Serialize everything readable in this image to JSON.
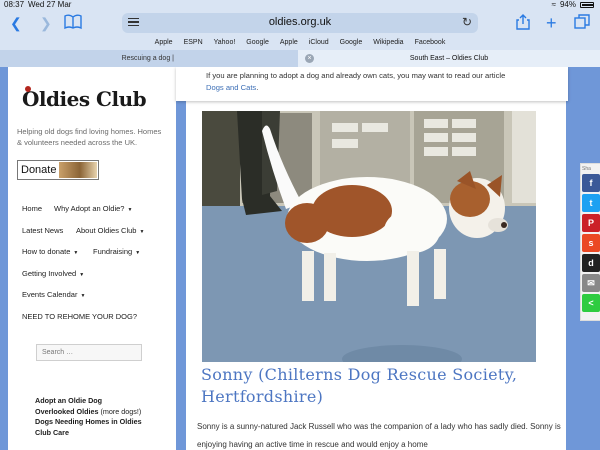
{
  "status_bar": {
    "time": "08:37",
    "date": "Wed 27 Mar",
    "battery": "94%"
  },
  "toolbar": {
    "url": "oldies.org.uk"
  },
  "favorites": [
    "Apple",
    "ESPN",
    "Yahoo!",
    "Google",
    "Apple",
    "iCloud",
    "Google",
    "Wikipedia",
    "Facebook"
  ],
  "tabs": [
    {
      "label": "Rescuing a dog |"
    },
    {
      "label": "South East – Oldies Club"
    }
  ],
  "sidebar": {
    "logo": "Oldies Club",
    "tagline": "Helping old dogs find loving homes. Homes & volunteers needed across the UK.",
    "donate_label": "Donate",
    "nav": [
      [
        "Home",
        "Why Adopt an Oldie?"
      ],
      [
        "Latest News",
        "About Oldies Club"
      ],
      [
        "How to donate",
        "Fundraising"
      ],
      [
        "Getting Involved"
      ],
      [
        "Events Calendar"
      ],
      [
        "NEED TO REHOME YOUR DOG?"
      ]
    ],
    "search_placeholder": "Search …",
    "links": [
      {
        "bold": "Adopt an Oldie Dog",
        "rest": ""
      },
      {
        "bold": "Overlooked Oldies",
        "rest": " (more dogs!)"
      },
      {
        "bold": "Dogs Needing Homes in Oldies Club Care",
        "rest": ""
      }
    ]
  },
  "notice": {
    "text": "If you are planning to adopt a dog and already own cats, you may want to read our article",
    "link": "Dogs and Cats",
    "after": "."
  },
  "post": {
    "title": "Sonny (Chilterns Dog Rescue Society, Hertfordshire)",
    "body": "Sonny is a sunny-natured Jack Russell who was the companion of a lady who has sadly died. Sonny is enjoying having an active time in rescue and would enjoy a home"
  },
  "share": {
    "label": "Sha",
    "buttons": [
      "facebook-icon",
      "twitter-icon",
      "pinterest-icon",
      "stumbleupon-icon",
      "delicious-icon",
      "email-icon",
      "share-icon"
    ]
  },
  "colors": {
    "accent": "#4d76c2",
    "frame": "#6f97d8",
    "ios_blue": "#2a7ae2"
  }
}
